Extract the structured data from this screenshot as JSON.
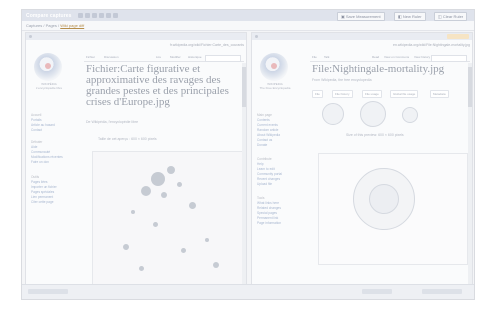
{
  "app": {
    "title": "Compare captures",
    "buttons": {
      "save_label": "Save Measurement",
      "new_label": "New Ruler",
      "clear_label": "Clear Ruler"
    }
  },
  "breadcrumb": {
    "prefix": "Captures / Pages / ",
    "current": "Wiki page diff"
  },
  "left_pane": {
    "url": "fr.wikipedia.org/wiki/Fichier:Carte_des_courants",
    "page_title": "Fichier:Carte figurative et approximative des ravages des grandes pestes et des principales crises d'Europe.jpg",
    "subtitle": "De Wikipédia, l'encyclopédie libre",
    "wordmark_line1": "WIKIPÉDIA",
    "wordmark_line2": "L'encyclopédie libre",
    "tabs": [
      "Fichier",
      "Discussion",
      "Lire",
      "Modifier",
      "Historique"
    ],
    "side_items": [
      "Accueil",
      "Portails",
      "Article au hasard",
      "Contact",
      "Débuter",
      "Aide",
      "Communauté",
      "Modifications récentes",
      "Faire un don",
      "Outils",
      "Pages liées",
      "Importer un fichier",
      "Pages spéciales",
      "Lien permanent",
      "Citer cette page"
    ],
    "caption": "Taille de cet aperçu : 600 × 600 pixels"
  },
  "right_pane": {
    "url": "en.wikipedia.org/wiki/File:Nightingale-mortality.jpg",
    "page_title": "File:Nightingale-mortality.jpg",
    "subtitle": "From Wikipedia, the free encyclopedia",
    "wordmark_line1": "WIKIPEDIA",
    "wordmark_line2": "The Free Encyclopedia",
    "tabs": [
      "File",
      "Talk",
      "Read",
      "View on Commons",
      "View history"
    ],
    "meta_tabs": [
      "File",
      "File history",
      "File usage",
      "Global file usage",
      "Metadata"
    ],
    "side_items": [
      "Main page",
      "Contents",
      "Current events",
      "Random article",
      "About Wikipedia",
      "Contact us",
      "Donate",
      "Contribute",
      "Help",
      "Learn to edit",
      "Community portal",
      "Recent changes",
      "Upload file",
      "Tools",
      "What links here",
      "Related changes",
      "Special pages",
      "Permanent link",
      "Page information"
    ],
    "caption": "Size of this preview: 600 × 600 pixels"
  },
  "colors": {
    "topbar": "#dfe3ec",
    "accent": "#f6e4c4",
    "link": "#a7b6cf"
  },
  "icons": [
    "window-icon",
    "grid-icon",
    "lock-icon",
    "bell-icon",
    "pencil-icon",
    "gear-icon",
    "save-icon",
    "ruler-icon",
    "trash-icon"
  ]
}
